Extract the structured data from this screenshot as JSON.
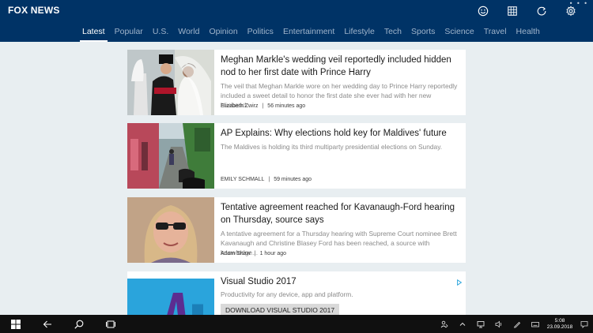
{
  "app": {
    "logo": "FOX NEWS"
  },
  "header_icons": [
    {
      "name": "smiley-icon"
    },
    {
      "name": "grid-icon"
    },
    {
      "name": "refresh-icon"
    },
    {
      "name": "gear-icon"
    }
  ],
  "nav": {
    "items": [
      {
        "label": "Latest",
        "active": true
      },
      {
        "label": "Popular"
      },
      {
        "label": "U.S."
      },
      {
        "label": "World"
      },
      {
        "label": "Opinion"
      },
      {
        "label": "Politics"
      },
      {
        "label": "Entertainment"
      },
      {
        "label": "Lifestyle"
      },
      {
        "label": "Tech"
      },
      {
        "label": "Sports"
      },
      {
        "label": "Science"
      },
      {
        "label": "Travel"
      },
      {
        "label": "Health"
      }
    ]
  },
  "articles": [
    {
      "title": "Meghan Markle's wedding veil reportedly included hidden nod to her first date with Prince Harry",
      "summary": "The veil that Meghan Markle wore on her wedding day to Prince Harry reportedly included a sweet detail to honor the first date she ever had with her new husband.",
      "author": "Elizabeth Zwirz",
      "time": "56 minutes ago"
    },
    {
      "title": "AP Explains: Why elections hold key for Maldives' future",
      "summary": "The Maldives is holding its third multiparty presidential elections on Sunday.",
      "author": "EMILY SCHMALL",
      "time": "59 minutes ago"
    },
    {
      "title": "Tentative agreement reached for Kavanaugh-Ford hearing on Thursday, source says",
      "summary": "A tentative agreement for a Thursday hearing with Supreme Court nominee Brett Kavanaugh and Christine Blasey Ford has been reached, a source with knowledge...",
      "author": "Adam Shaw",
      "time": "1 hour ago"
    }
  ],
  "ad": {
    "title": "Visual Studio 2017",
    "tagline": "Productivity for any device, app and platform.",
    "cta": "DOWNLOAD VISUAL STUDIO 2017"
  },
  "taskbar": {
    "time": "5:08",
    "date": "23.09.2018"
  }
}
